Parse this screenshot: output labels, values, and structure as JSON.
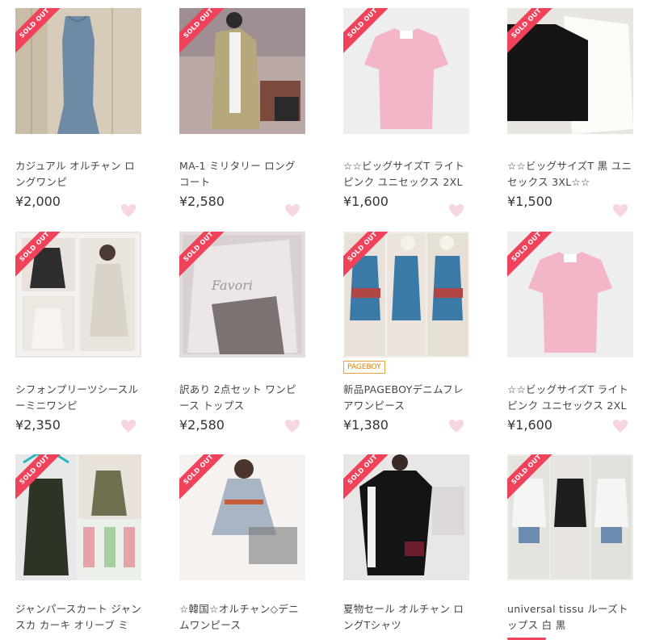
{
  "ribbon_label": "SOLD OUT",
  "accent_color": "#f0425a",
  "heart_color": "#f6d7de",
  "items": [
    {
      "title": "カジュアル オルチャン ロングワンピ",
      "price": "¥2,000",
      "sold": true
    },
    {
      "title": "MA-1 ミリタリー ロングコート",
      "price": "¥2,580",
      "sold": true
    },
    {
      "title": "☆☆ビッグサイズT ライトピンク ユニセックス 2XL",
      "price": "¥1,600",
      "sold": true
    },
    {
      "title": "☆☆ビッグサイズT 黒 ユニセックス 3XL☆☆",
      "price": "¥1,500",
      "sold": true
    },
    {
      "title": "シフォンプリーツシースルーミニワンピ",
      "price": "¥2,350",
      "sold": true
    },
    {
      "title": "訳あり 2点セット ワンピース トップス",
      "price": "¥2,580",
      "sold": true
    },
    {
      "title": "新品PAGEBOYデニムフレアワンピース",
      "price": "¥1,380",
      "sold": true,
      "badge": "PAGEBOY"
    },
    {
      "title": "☆☆ビッグサイズT ライトピンク ユニセックス 2XL",
      "price": "¥1,600",
      "sold": true
    },
    {
      "title": "ジャンパースカート ジャンスカ カーキ オリーブ ミ",
      "price": "",
      "sold": true
    },
    {
      "title": "☆韓国☆オルチャン◇デニムワンピース",
      "price": "",
      "sold": true
    },
    {
      "title": "夏物セール オルチャン ロングTシャツ",
      "price": "",
      "sold": true
    },
    {
      "title": "universal tissu ルーズトップス 白 黒",
      "price": "",
      "sold": true
    }
  ],
  "thumbs": [
    {
      "icon": "blue-knit-dress-photo"
    },
    {
      "icon": "khaki-long-coat-photo"
    },
    {
      "icon": "pink-tshirt-photo"
    },
    {
      "icon": "black-white-tshirts-photo"
    },
    {
      "icon": "chiffon-dress-collage-photo"
    },
    {
      "icon": "two-piece-set-photo"
    },
    {
      "icon": "denim-dress-collage-photo"
    },
    {
      "icon": "pink-tshirt-photo"
    },
    {
      "icon": "khaki-jumper-skirt-collage-photo"
    },
    {
      "icon": "denim-dress-mirror-photo"
    },
    {
      "icon": "black-long-tshirt-photo"
    },
    {
      "icon": "loose-tops-collage-photo"
    }
  ]
}
